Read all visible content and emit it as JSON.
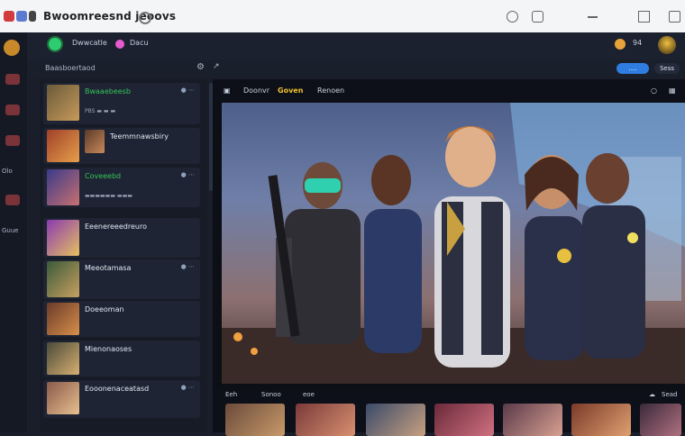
{
  "browser": {
    "title": "Bwoomreesnd jeoovs",
    "colors": {
      "bar": "#f4f5f7",
      "accent_red": "#d23b3b"
    }
  },
  "rail": {
    "labels": [
      "Olo",
      "Guue"
    ]
  },
  "header": {
    "user1": "Dwwcatle",
    "user2": "Dacu",
    "coin_count": "94",
    "status_colors": {
      "online": "#2ecc71",
      "pink": "#e85bd0"
    }
  },
  "subheader": {
    "section_label": "Baasboertaod",
    "primary_button": "....",
    "secondary_button": "Sess"
  },
  "list": {
    "items": [
      {
        "name": "Bwaaebeesb",
        "sub": "PBS ▬ ▬ ▬"
      },
      {
        "name": "Teemmnawsbiry",
        "sub": ""
      },
      {
        "name": "Coveeebd",
        "sub": "▬▬▬▬▬▬ ▬▬▬"
      },
      {
        "name": "Eeenereeedreuro",
        "sub": ""
      },
      {
        "name": "Meeotamasa",
        "sub": ""
      },
      {
        "name": "Doeeoman",
        "sub": ""
      },
      {
        "name": "Mienonaoses",
        "sub": ""
      },
      {
        "name": "Eooonenaceatasd",
        "sub": ""
      }
    ]
  },
  "viewer": {
    "bar_label_1": "Doonvr",
    "bar_label_gold": "Goven",
    "bar_label_2": "Renoen",
    "strip_label_1": "Eeh",
    "strip_label_2": "Sonoo",
    "strip_label_3": "eoe",
    "strip_label_4": "Sead"
  }
}
